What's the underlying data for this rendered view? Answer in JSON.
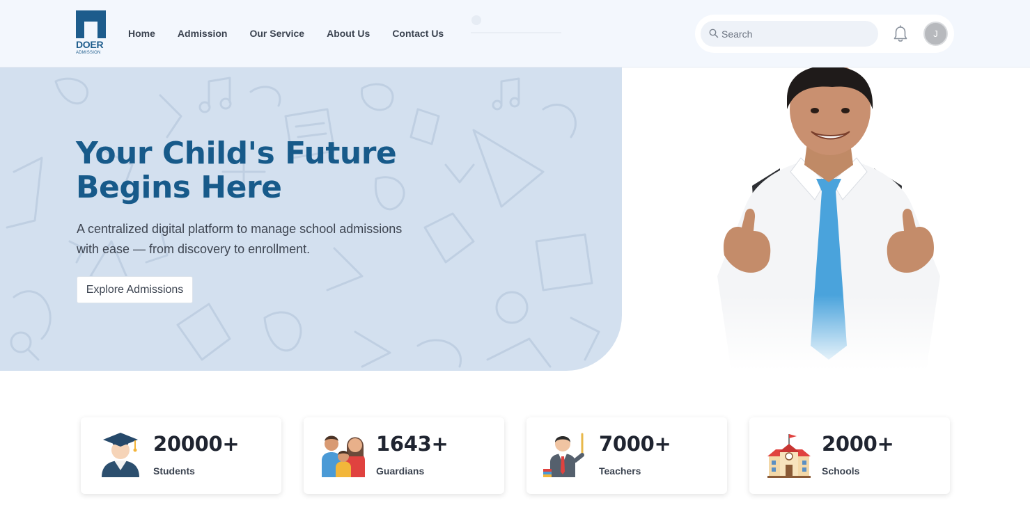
{
  "brand": {
    "name": "DOER",
    "sub": "ADMISSION",
    "color": "#1d5c8c"
  },
  "nav": {
    "items": [
      {
        "label": "Home"
      },
      {
        "label": "Admission"
      },
      {
        "label": "Our Service"
      },
      {
        "label": "About Us"
      },
      {
        "label": "Contact Us"
      }
    ]
  },
  "header": {
    "search_placeholder": "Search",
    "avatar_initial": "J"
  },
  "hero": {
    "title": "Your Child's Future Begins Here",
    "description": "A centralized digital platform to manage school admissions with ease — from discovery to enrollment.",
    "cta_label": "Explore Admissions",
    "title_color": "#175a8a",
    "background_color": "#d3e0ef"
  },
  "stats": [
    {
      "value": "20000+",
      "label": "Students",
      "icon": "graduate-icon"
    },
    {
      "value": "1643+",
      "label": "Guardians",
      "icon": "family-icon"
    },
    {
      "value": "7000+",
      "label": "Teachers",
      "icon": "teacher-icon"
    },
    {
      "value": "2000+",
      "label": "Schools",
      "icon": "school-building-icon"
    }
  ]
}
